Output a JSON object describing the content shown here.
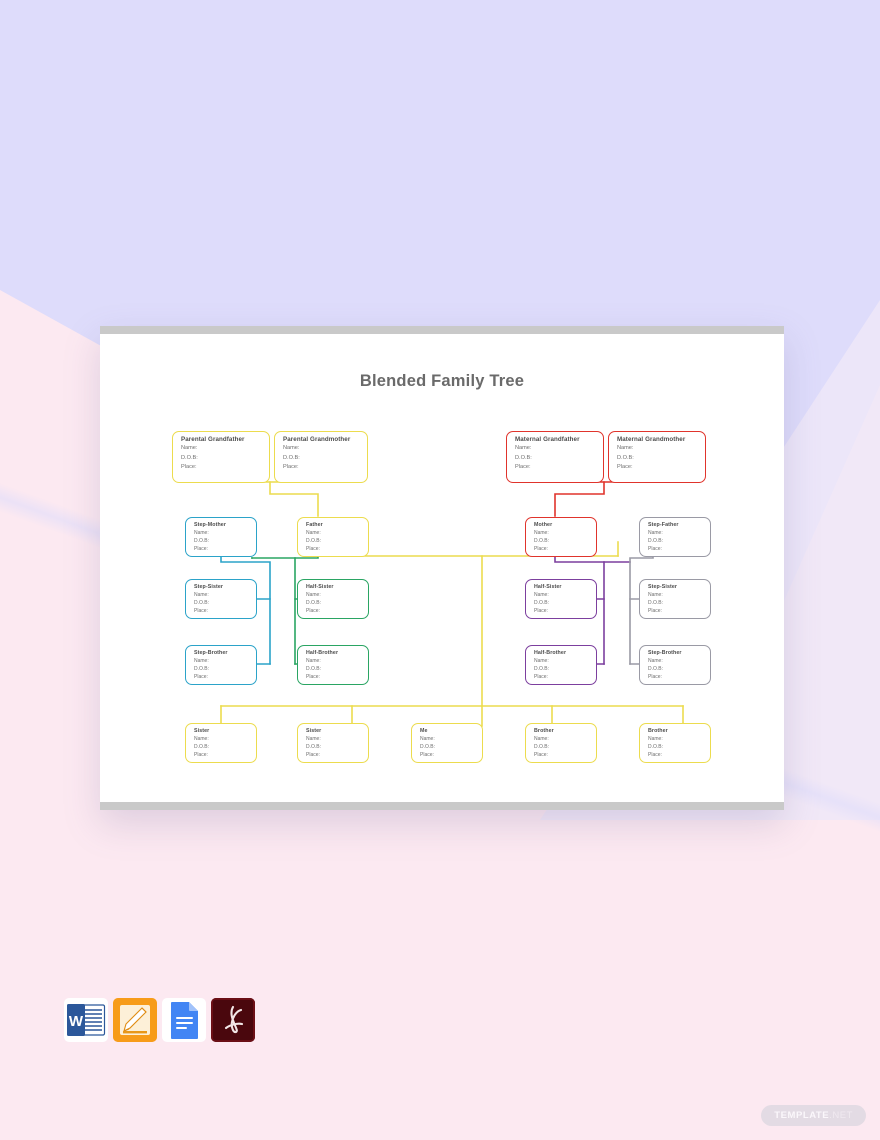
{
  "document": {
    "title": "Blended Family Tree"
  },
  "fields": {
    "name": "Name:",
    "dob": "D.O.B:",
    "place": "Place:"
  },
  "colors": {
    "yellow": "#ecdc4e",
    "red": "#e0342c",
    "cyan": "#2ba3c9",
    "green": "#2aa563",
    "purple": "#7c3f9e",
    "gray": "#9a9aa5",
    "background_lavender": "#dedcfb",
    "background_pink": "#fce9f1",
    "title_text": "#6a6a6a"
  },
  "chart_data": {
    "type": "diagram",
    "title": "Blended Family Tree",
    "nodes": [
      {
        "id": "paternal-grandfather",
        "role": "Parental Grandfather",
        "color": "yellow",
        "generation": 1,
        "side": "left"
      },
      {
        "id": "paternal-grandmother",
        "role": "Parental Grandmother",
        "color": "yellow",
        "generation": 1,
        "side": "left"
      },
      {
        "id": "maternal-grandfather",
        "role": "Maternal Grandfather",
        "color": "red",
        "generation": 1,
        "side": "right"
      },
      {
        "id": "maternal-grandmother",
        "role": "Maternal Grandmother",
        "color": "red",
        "generation": 1,
        "side": "right"
      },
      {
        "id": "step-mother",
        "role": "Step-Mother",
        "color": "cyan",
        "generation": 2,
        "side": "left"
      },
      {
        "id": "father",
        "role": "Father",
        "color": "yellow",
        "generation": 2,
        "side": "left"
      },
      {
        "id": "mother",
        "role": "Mother",
        "color": "red",
        "generation": 2,
        "side": "right"
      },
      {
        "id": "step-father",
        "role": "Step-Father",
        "color": "gray",
        "generation": 2,
        "side": "right"
      },
      {
        "id": "step-sister-left",
        "role": "Step-Sister",
        "color": "cyan",
        "generation": 3,
        "side": "left"
      },
      {
        "id": "half-sister-left",
        "role": "Half-Sister",
        "color": "green",
        "generation": 3,
        "side": "left"
      },
      {
        "id": "half-sister-right",
        "role": "Half-Sister",
        "color": "purple",
        "generation": 3,
        "side": "right"
      },
      {
        "id": "step-sister-right",
        "role": "Step-Sister",
        "color": "gray",
        "generation": 3,
        "side": "right"
      },
      {
        "id": "step-brother-left",
        "role": "Step-Brother",
        "color": "cyan",
        "generation": 4,
        "side": "left"
      },
      {
        "id": "half-brother-left",
        "role": "Half-Brother",
        "color": "green",
        "generation": 4,
        "side": "left"
      },
      {
        "id": "half-brother-right",
        "role": "Half-Brother",
        "color": "purple",
        "generation": 4,
        "side": "right"
      },
      {
        "id": "step-brother-right",
        "role": "Step-Brother",
        "color": "gray",
        "generation": 4,
        "side": "right"
      },
      {
        "id": "sister-1",
        "role": "Sister",
        "color": "yellow",
        "generation": 5,
        "side": "center"
      },
      {
        "id": "sister-2",
        "role": "Sister",
        "color": "yellow",
        "generation": 5,
        "side": "center"
      },
      {
        "id": "me",
        "role": "Me",
        "color": "yellow",
        "generation": 5,
        "side": "center"
      },
      {
        "id": "brother-1",
        "role": "Brother",
        "color": "yellow",
        "generation": 5,
        "side": "center"
      },
      {
        "id": "brother-2",
        "role": "Brother",
        "color": "yellow",
        "generation": 5,
        "side": "center"
      }
    ],
    "node_fields": [
      "Name:",
      "D.O.B:",
      "Place:"
    ],
    "edges": [
      {
        "from": "paternal-grandfather",
        "to": "father",
        "color": "yellow"
      },
      {
        "from": "paternal-grandmother",
        "to": "father",
        "color": "yellow"
      },
      {
        "from": "maternal-grandfather",
        "to": "mother",
        "color": "red"
      },
      {
        "from": "maternal-grandmother",
        "to": "mother",
        "color": "red"
      },
      {
        "from": "step-mother",
        "to": "step-sister-left",
        "color": "cyan"
      },
      {
        "from": "step-mother",
        "to": "step-brother-left",
        "color": "cyan"
      },
      {
        "from": "father",
        "to": "half-sister-left",
        "color": "green"
      },
      {
        "from": "father",
        "to": "half-brother-left",
        "color": "green"
      },
      {
        "from": "mother",
        "to": "half-sister-right",
        "color": "purple"
      },
      {
        "from": "mother",
        "to": "half-brother-right",
        "color": "purple"
      },
      {
        "from": "step-father",
        "to": "step-sister-right",
        "color": "gray"
      },
      {
        "from": "step-father",
        "to": "step-brother-right",
        "color": "gray"
      },
      {
        "from": "father",
        "to": "sister-1",
        "color": "yellow"
      },
      {
        "from": "father",
        "to": "sister-2",
        "color": "yellow"
      },
      {
        "from": "father",
        "to": "me",
        "color": "yellow"
      },
      {
        "from": "father",
        "to": "brother-1",
        "color": "yellow"
      },
      {
        "from": "father",
        "to": "brother-2",
        "color": "yellow"
      },
      {
        "from": "mother",
        "to": "me",
        "color": "yellow"
      }
    ]
  },
  "formats": [
    {
      "name": "microsoft-word",
      "label": "W"
    },
    {
      "name": "apple-pages",
      "label": ""
    },
    {
      "name": "google-docs",
      "label": ""
    },
    {
      "name": "adobe-pdf",
      "label": ""
    }
  ],
  "watermark": {
    "brand": "TEMPLATE",
    "tld": ".NET"
  }
}
